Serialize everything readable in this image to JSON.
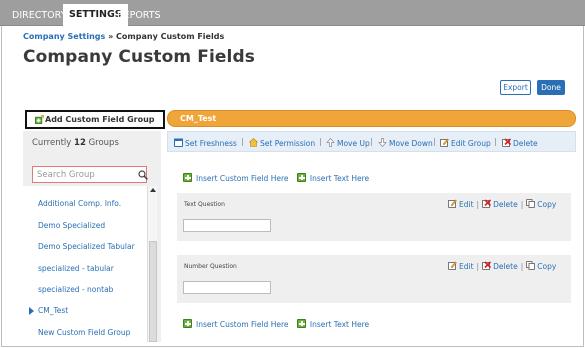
{
  "nav": {
    "tabs": [
      {
        "label": "DIRECTORY",
        "active": false
      },
      {
        "label": "SETTINGS",
        "active": true
      },
      {
        "label": "REPORTS",
        "active": false
      }
    ]
  },
  "breadcrumb": {
    "parent": "Company Settings",
    "separator": " » ",
    "current": "Company Custom Fields"
  },
  "page": {
    "title": "Company Custom Fields"
  },
  "actions": {
    "export_label": "Export",
    "done_label": "Done"
  },
  "sidebar": {
    "add_group_label": "Add Custom Field Group",
    "count_prefix": "Currently ",
    "count_value": "12",
    "count_suffix": " Groups",
    "search_placeholder": "Search Group",
    "groups": [
      {
        "label": "Additional Comp. Info."
      },
      {
        "label": "Demo Specialized"
      },
      {
        "label": "Demo Specialized Tabular"
      },
      {
        "label": "specialized - tabular"
      },
      {
        "label": "specialized - nontab"
      },
      {
        "label": "CM_Test"
      },
      {
        "label": "New Custom Field Group"
      }
    ]
  },
  "group": {
    "name": "CM_Test",
    "toolbar": {
      "set_freshness": "Set Freshness",
      "set_permission": "Set Permission",
      "move_up": "Move Up",
      "move_down": "Move Down",
      "edit_group": "Edit Group",
      "delete": "Delete"
    },
    "insert_field_label": "Insert Custom Field Here",
    "insert_text_label": "Insert Text Here",
    "questions": [
      {
        "label": "Text Question",
        "value": ""
      },
      {
        "label": "Number Question",
        "value": ""
      }
    ],
    "question_actions": {
      "edit": "Edit",
      "delete": "Delete",
      "copy": "Copy"
    }
  },
  "colors": {
    "accent": "#2a6fb5",
    "group_header": "#f0a53a",
    "toolbar_bg": "#e6eef8"
  }
}
